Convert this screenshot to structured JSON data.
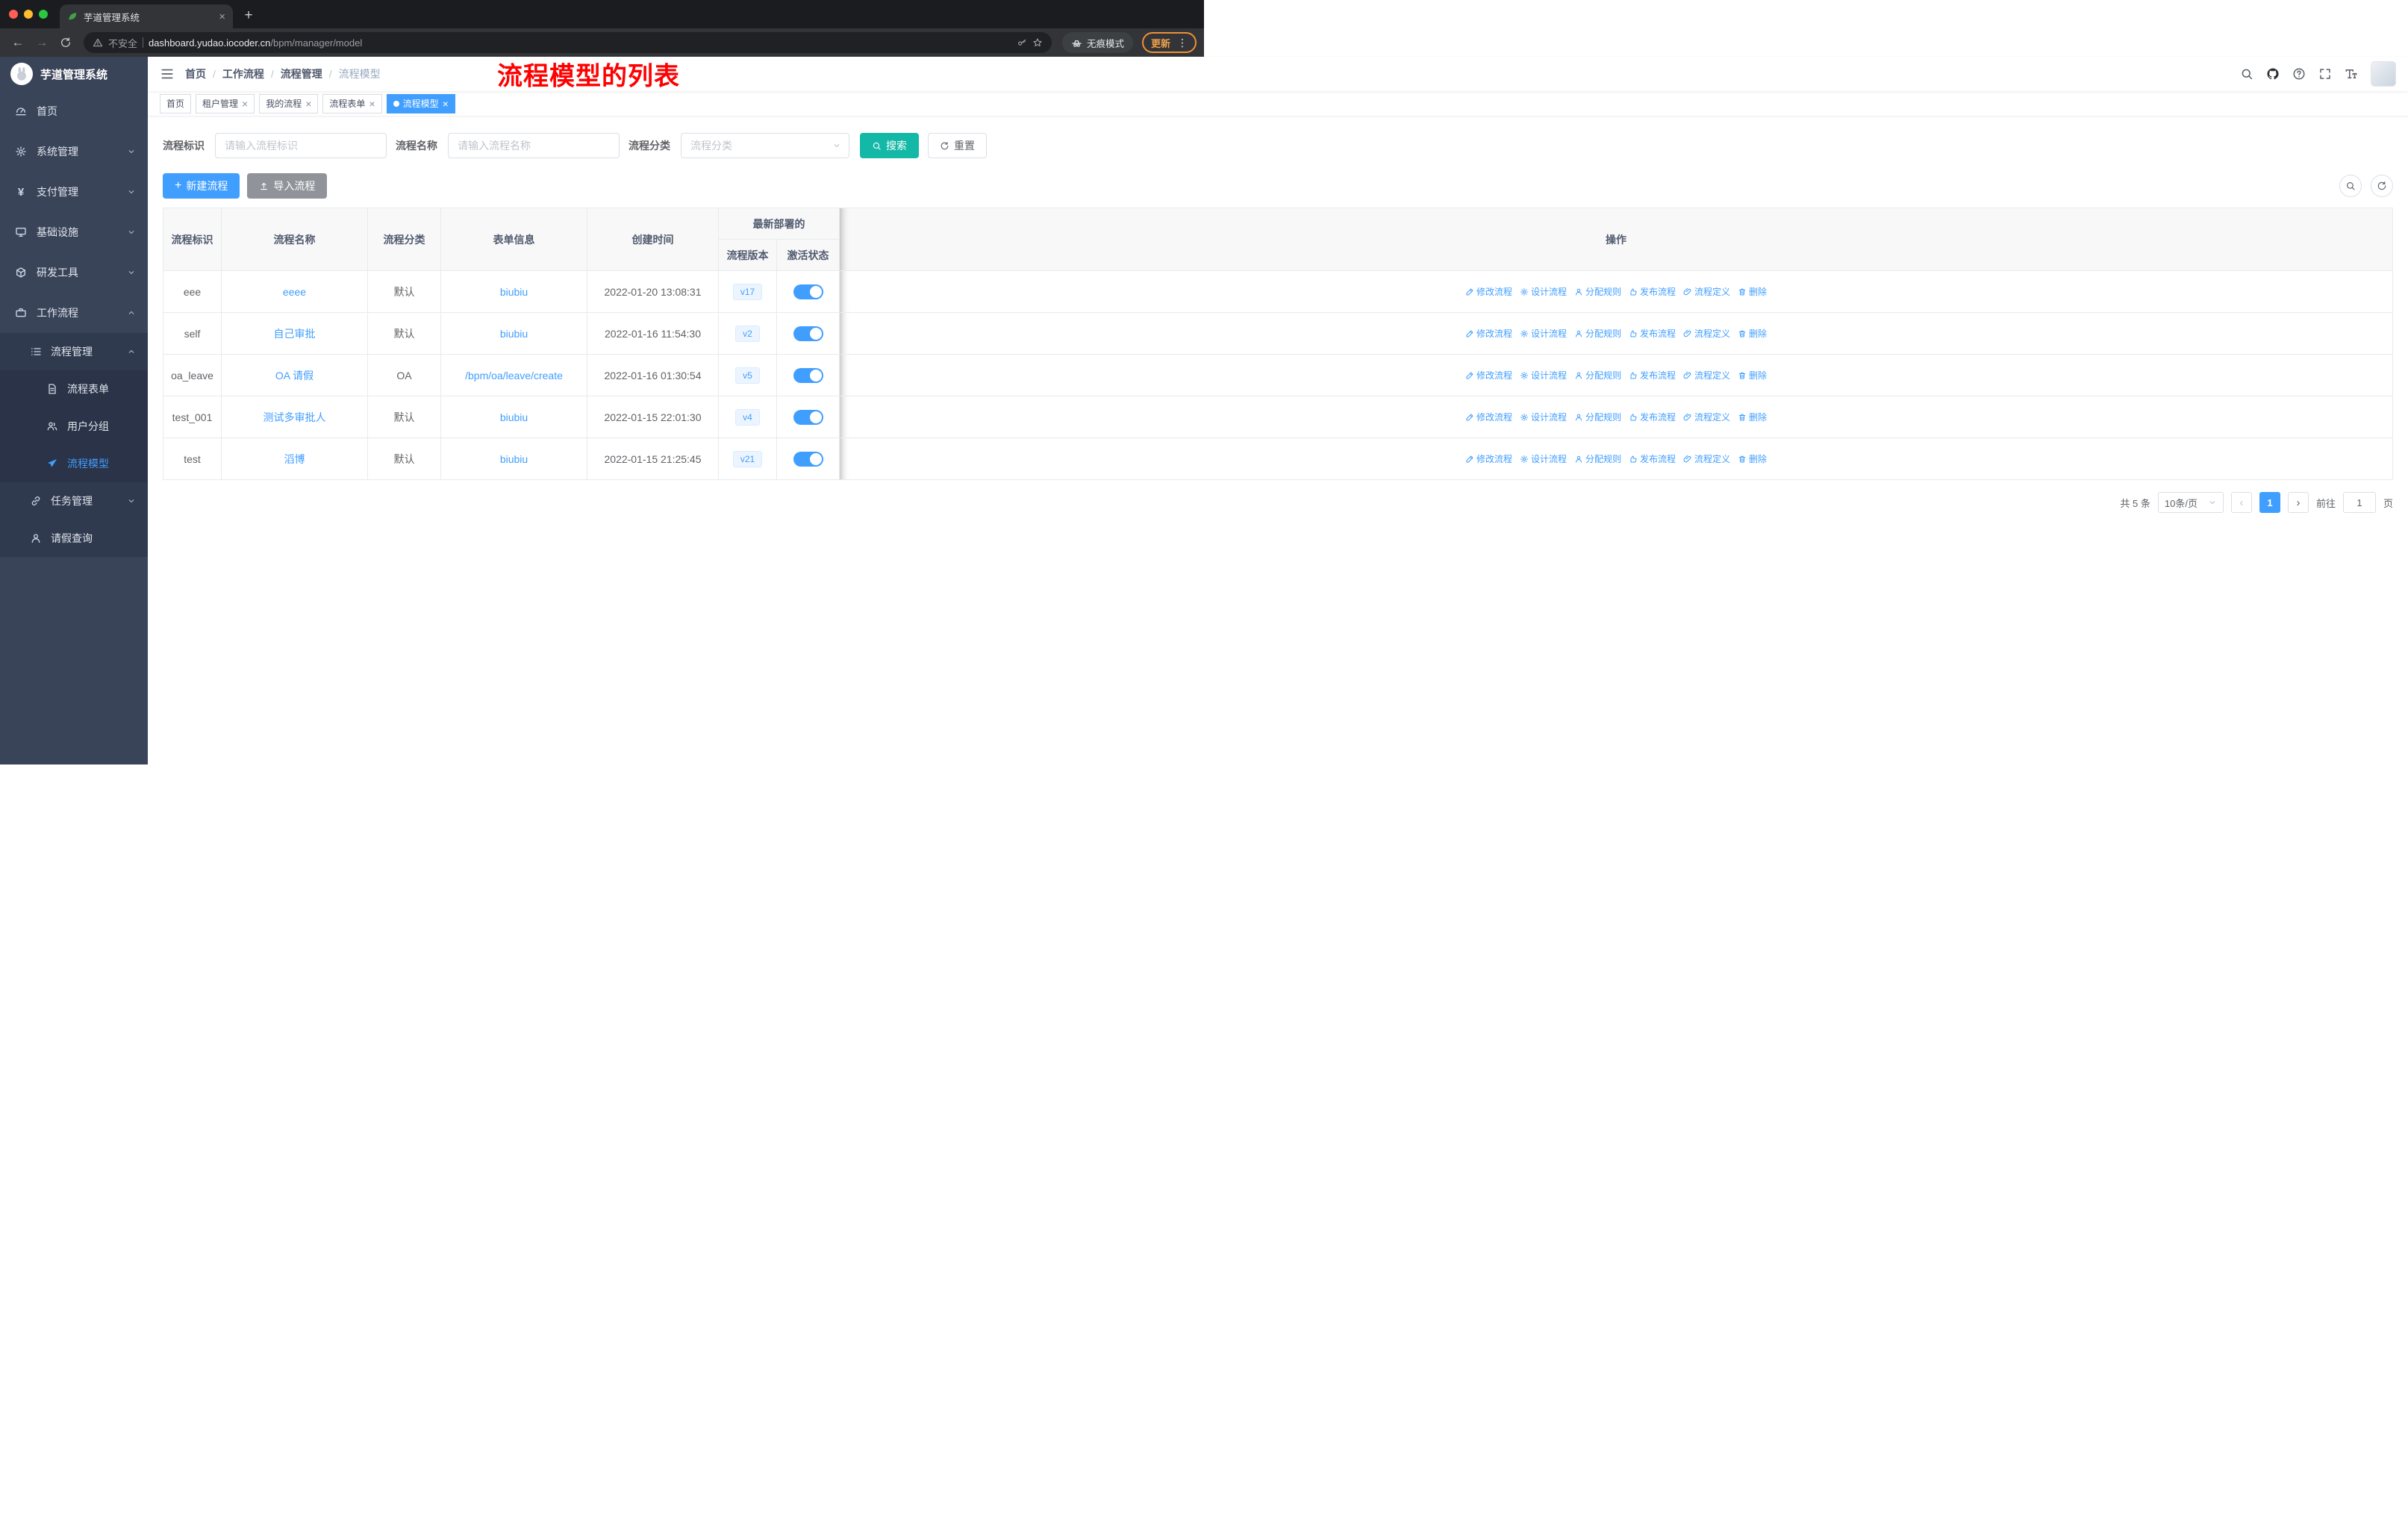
{
  "browser": {
    "tab_title": "芋道管理系统",
    "security_label": "不安全",
    "url_domain": "dashboard.yudao.iocoder.cn",
    "url_path": "/bpm/manager/model",
    "incognito_label": "无痕模式",
    "update_label": "更新"
  },
  "icons": {
    "close": "×",
    "plus": "+",
    "back": "←",
    "forward": "→",
    "menu_dots": "⋮",
    "prev": "‹",
    "next": "›",
    "yen": "¥"
  },
  "sidebar": {
    "logo_title": "芋道管理系统",
    "items": [
      "首页",
      "系统管理",
      "支付管理",
      "基础设施",
      "研发工具",
      "工作流程"
    ],
    "workflow": {
      "process_management": "流程管理",
      "process_children": [
        "流程表单",
        "用户分组",
        "流程模型"
      ],
      "task_management": "任务管理",
      "leave_query": "请假查询"
    }
  },
  "navbar": {
    "breadcrumb": [
      "首页",
      "工作流程",
      "流程管理",
      "流程模型"
    ],
    "separator": "/",
    "annotation": "流程模型的列表"
  },
  "tags": [
    {
      "label": "首页"
    },
    {
      "label": "租户管理"
    },
    {
      "label": "我的流程"
    },
    {
      "label": "流程表单"
    },
    {
      "label": "流程模型"
    }
  ],
  "filters": {
    "key_label": "流程标识",
    "key_placeholder": "请输入流程标识",
    "name_label": "流程名称",
    "name_placeholder": "请输入流程名称",
    "category_label": "流程分类",
    "category_placeholder": "流程分类",
    "search_label": "搜索",
    "reset_label": "重置"
  },
  "toolbar": {
    "create_label": "新建流程",
    "import_label": "导入流程"
  },
  "table": {
    "headers": {
      "key": "流程标识",
      "name": "流程名称",
      "category": "流程分类",
      "form": "表单信息",
      "created": "创建时间",
      "deployment_group": "最新部署的",
      "version": "流程版本",
      "status": "激活状态",
      "actions": "操作"
    },
    "row_actions": [
      "修改流程",
      "设计流程",
      "分配规则",
      "发布流程",
      "流程定义",
      "删除"
    ],
    "rows": [
      {
        "key": "eee",
        "name": "eeee",
        "category": "默认",
        "form": "biubiu",
        "created": "2022-01-20 13:08:31",
        "version": "v17",
        "active": true
      },
      {
        "key": "self",
        "name": "自己审批",
        "category": "默认",
        "form": "biubiu",
        "created": "2022-01-16 11:54:30",
        "version": "v2",
        "active": true
      },
      {
        "key": "oa_leave",
        "name": "OA 请假",
        "category": "OA",
        "form": "/bpm/oa/leave/create",
        "created": "2022-01-16 01:30:54",
        "version": "v5",
        "active": true
      },
      {
        "key": "test_001",
        "name": "测试多审批人",
        "category": "默认",
        "form": "biubiu",
        "created": "2022-01-15 22:01:30",
        "version": "v4",
        "active": true
      },
      {
        "key": "test",
        "name": "滔博",
        "category": "默认",
        "form": "biubiu",
        "created": "2022-01-15 21:25:45",
        "version": "v21",
        "active": true
      }
    ]
  },
  "pagination": {
    "total": "共 5 条",
    "page_size": "10条/页",
    "page": "1",
    "goto_label": "前往",
    "goto_value": "1",
    "unit_label": "页"
  },
  "colors": {
    "primary_blue": "#409eff",
    "search_button_teal": "#13b8a6",
    "annotation_red": "#ff0000",
    "sidebar_bg": "#3a4459",
    "version_badge_bg": "#ecf5ff",
    "tag_active_bg": "#409eff"
  }
}
